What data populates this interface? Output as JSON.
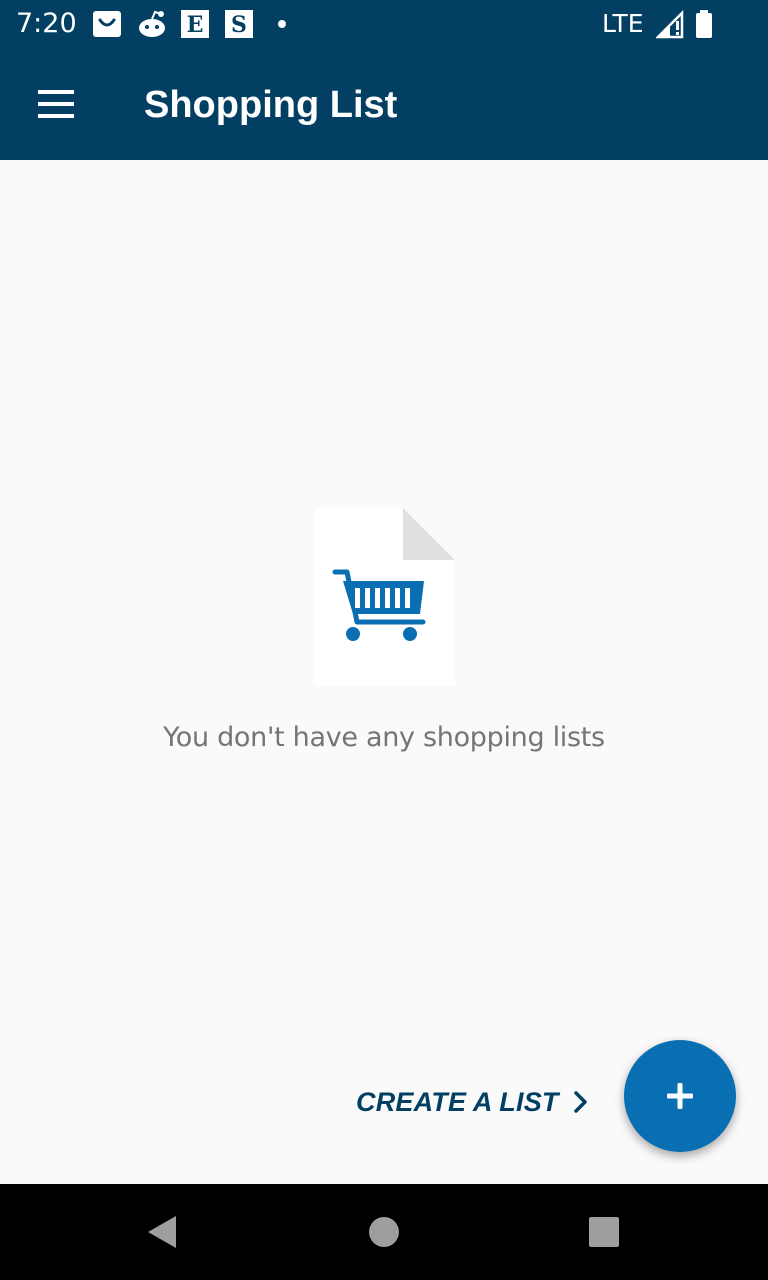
{
  "status_bar": {
    "time": "7:20",
    "notification_icons": [
      "shopping-bag-icon",
      "reddit-icon",
      "etsy-icon",
      "s-app-icon",
      "dot-icon"
    ],
    "network": "LTE"
  },
  "app_bar": {
    "title": "Shopping List"
  },
  "empty_state": {
    "message": "You don't have any shopping lists"
  },
  "actions": {
    "create_list_label": "CREATE A LIST"
  },
  "colors": {
    "primary": "#033f63",
    "accent": "#0a6fb2",
    "background": "#fafafa",
    "empty_text": "#757575"
  }
}
